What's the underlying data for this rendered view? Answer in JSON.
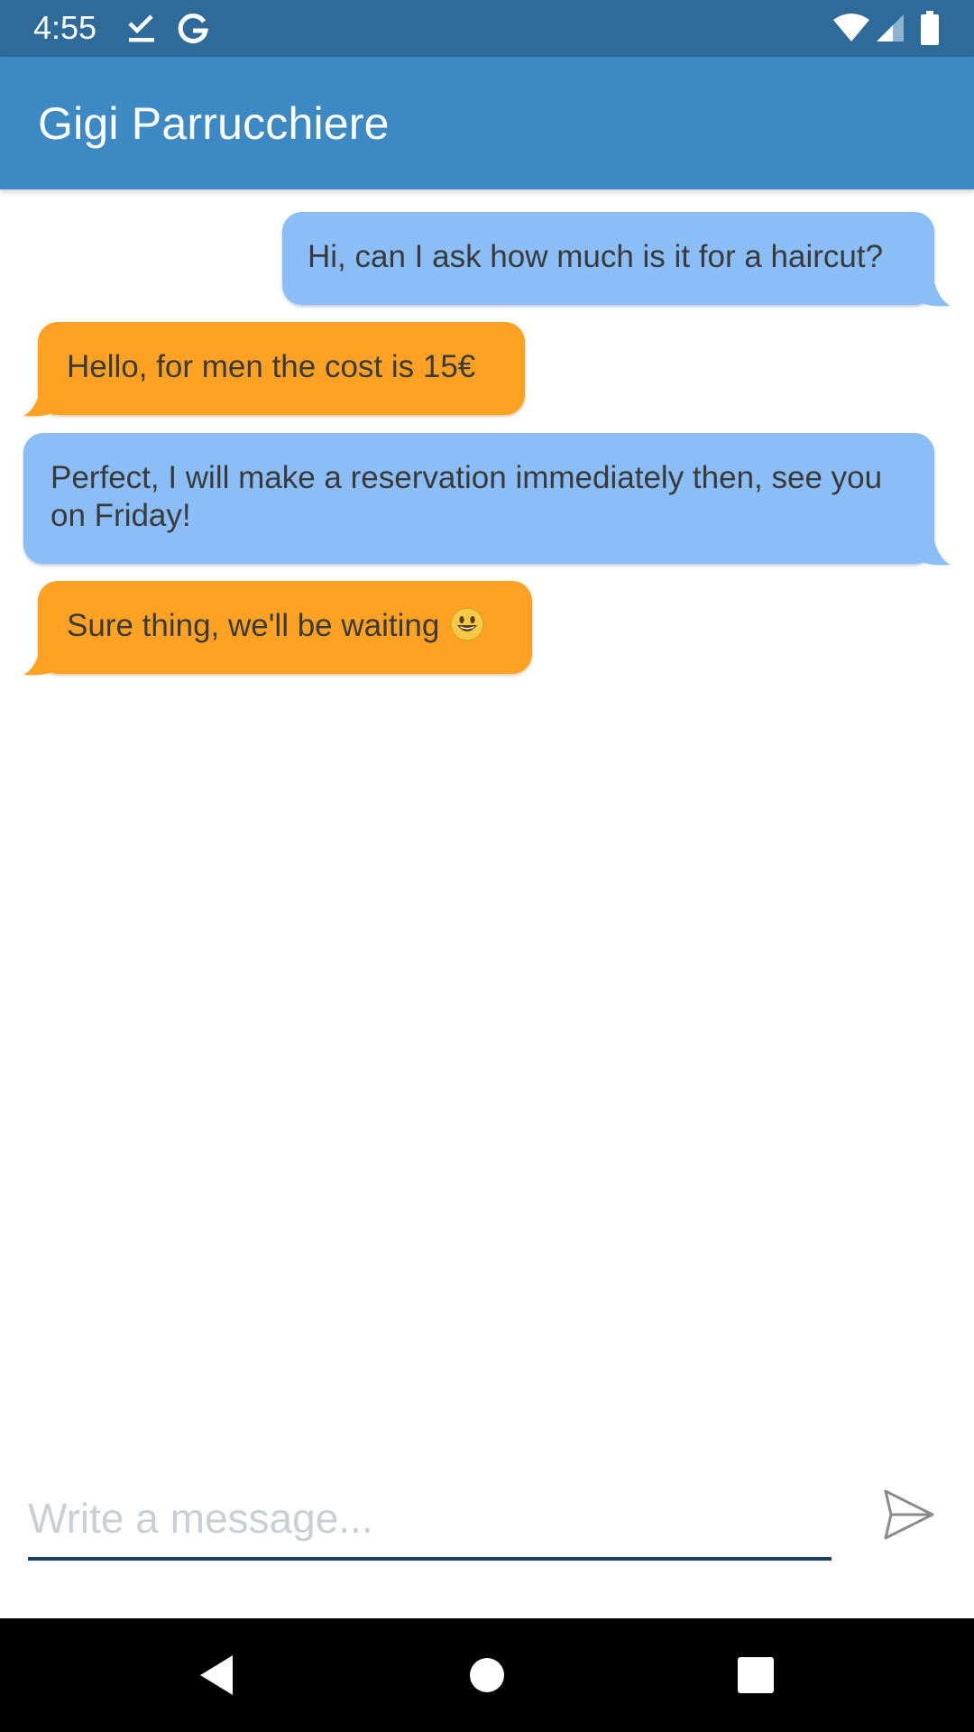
{
  "status_bar": {
    "time": "4:55",
    "icons": [
      "download-done-icon",
      "google-icon",
      "wifi-icon",
      "signal-icon",
      "battery-icon"
    ]
  },
  "app_bar": {
    "title": "Gigi Parrucchiere",
    "color": "#3d89c3"
  },
  "messages": [
    {
      "direction": "outgoing",
      "text": "Hi, can I ask how much is it for a haircut?"
    },
    {
      "direction": "incoming",
      "text": "Hello, for men the cost is 15€"
    },
    {
      "direction": "outgoing",
      "text": "Perfect, I will make a reservation immediately then, see you on Friday!"
    },
    {
      "direction": "incoming",
      "text": "Sure thing, we'll be waiting",
      "emoji": "smiley-icon"
    }
  ],
  "colors": {
    "outgoing_bubble": "#8bbdf7",
    "incoming_bubble": "#ffa223",
    "status_bar": "#2e6b9b"
  },
  "composer": {
    "placeholder": "Write a message...",
    "value": "",
    "send_icon": "send-icon"
  },
  "nav_bar": {
    "icons": [
      "back-icon",
      "home-icon",
      "recents-icon"
    ]
  }
}
